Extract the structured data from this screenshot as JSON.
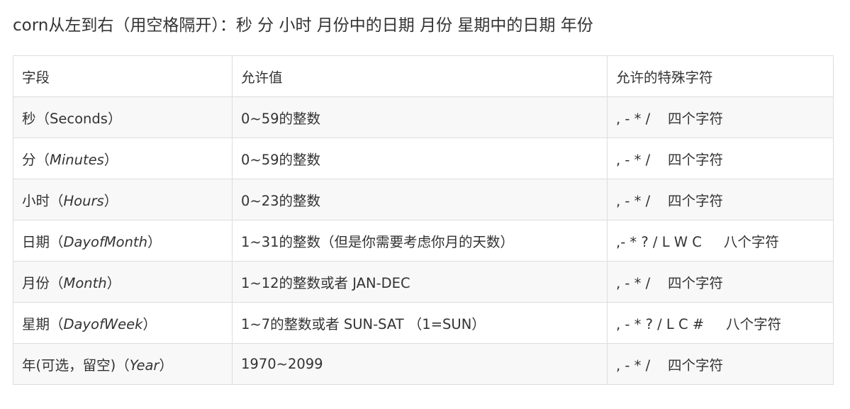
{
  "heading": "corn从左到右（用空格隔开）：秒 分 小时 月份中的日期 月份 星期中的日期 年份",
  "table": {
    "headers": [
      "字段",
      "允许值",
      "允许的特殊字符"
    ],
    "rows": [
      {
        "field_cn": "秒（",
        "field_en": "Seconds",
        "field_close": "）",
        "italic": false,
        "allowed": "0~59的整数",
        "special": ", - * /    四个字符"
      },
      {
        "field_cn": "分（",
        "field_en": "Minutes",
        "field_close": "）",
        "italic": true,
        "allowed": "0~59的整数",
        "special": ", - * /    四个字符"
      },
      {
        "field_cn": "小时（",
        "field_en": "Hours",
        "field_close": "）",
        "italic": true,
        "allowed": "0~23的整数",
        "special": ", - * /    四个字符"
      },
      {
        "field_cn": "日期（",
        "field_en": "DayofMonth",
        "field_close": "）",
        "italic": true,
        "allowed": "1~31的整数（但是你需要考虑你月的天数）",
        "special": ",- * ? / L W C     八个字符"
      },
      {
        "field_cn": "月份（",
        "field_en": "Month",
        "field_close": "）",
        "italic": true,
        "allowed": "1~12的整数或者 JAN-DEC",
        "special": ", - * /    四个字符"
      },
      {
        "field_cn": "星期（",
        "field_en": "DayofWeek",
        "field_close": "）",
        "italic": true,
        "allowed": "1~7的整数或者 SUN-SAT （1=SUN）",
        "special": ", - * ? / L C #     八个字符"
      },
      {
        "field_cn": "年(可选，留空)（",
        "field_en": "Year",
        "field_close": "）",
        "italic": true,
        "allowed": "1970~2099",
        "special": ", - * /    四个字符"
      }
    ]
  }
}
